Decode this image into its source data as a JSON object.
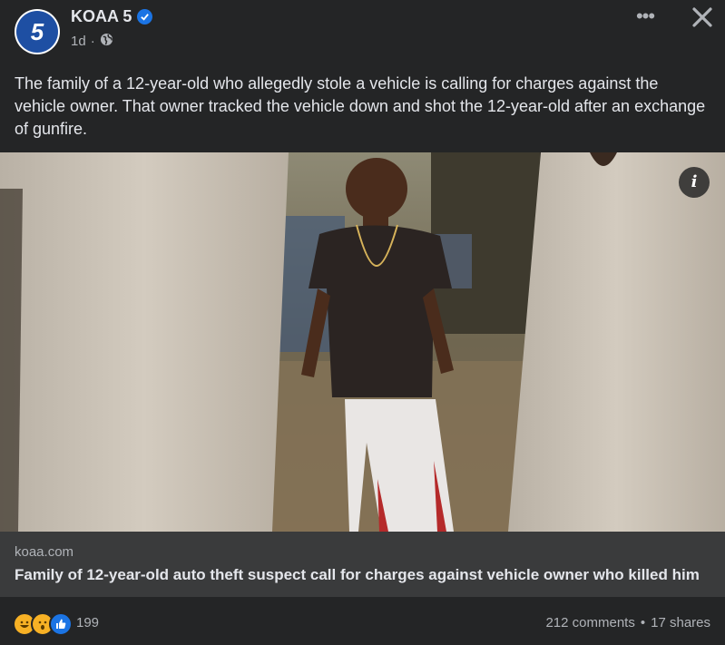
{
  "post": {
    "page_name": "KOAA 5",
    "avatar_text": "5",
    "time": "1d",
    "separator": "·",
    "more_label": "•••",
    "caption": "The family of a 12-year-old who allegedly stole a vehicle is calling for charges against the vehicle owner. That owner tracked the vehicle down and shot the 12-year-old after an exchange of gunfire.",
    "info_label": "i"
  },
  "link": {
    "domain": "koaa.com",
    "title": "Family of 12-year-old auto theft suspect call for charges against vehicle owner who killed him"
  },
  "footer": {
    "reaction_icons": [
      "laugh-emoji",
      "wow-emoji",
      "like-icon"
    ],
    "reaction_count": "199",
    "comments": "212 comments",
    "dot": "•",
    "shares": "17 shares"
  },
  "colors": {
    "background": "#242526",
    "link_box": "#3a3b3c",
    "verified": "#1b74e4",
    "brand_blue": "#1e4fa3"
  }
}
